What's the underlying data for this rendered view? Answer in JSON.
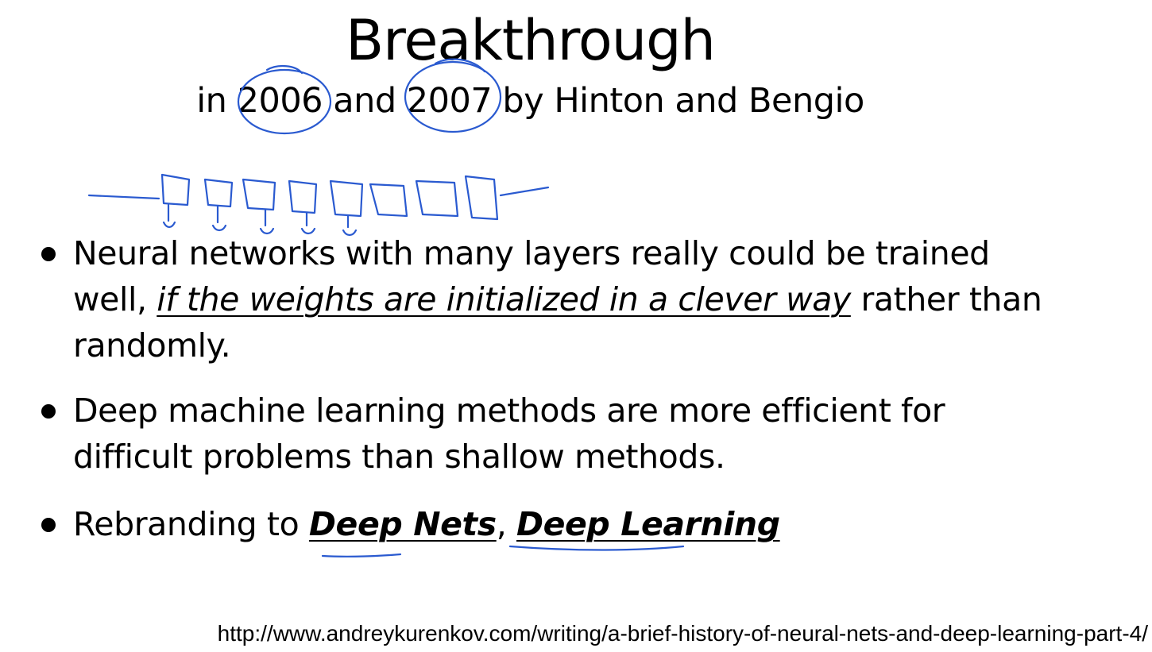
{
  "slide": {
    "title": "Breakthrough",
    "subtitle": {
      "prefix": "in ",
      "year1": "2006",
      "middle": " and ",
      "year2": "2007",
      "suffix": " by Hinton and Bengio"
    },
    "bullets": [
      {
        "text_before": "Neural networks with many layers really could be trained well, ",
        "emphasis": "if the weights are initialized in a clever way",
        "text_after": " rather than randomly."
      },
      {
        "text": "Deep machine learning methods are more efficient for difficult problems than shallow methods."
      },
      {
        "text_before": "Rebranding to ",
        "emphasis1": "Deep Nets",
        "separator": ", ",
        "emphasis2": "Deep Learning"
      }
    ],
    "source_url": "http://www.andreykurenkov.com/writing/a-brief-history-of-neural-nets-and-deep-learning-part-4/"
  },
  "colors": {
    "background": "#ffffff",
    "text": "#000000",
    "annotation_ink": "#2a5ad0"
  },
  "annotations": {
    "circled_years": [
      "2006",
      "2007"
    ],
    "drawing": "hand-drawn-layer-stack",
    "underlined_terms": [
      "Deep Nets",
      "Deep Learning"
    ]
  }
}
